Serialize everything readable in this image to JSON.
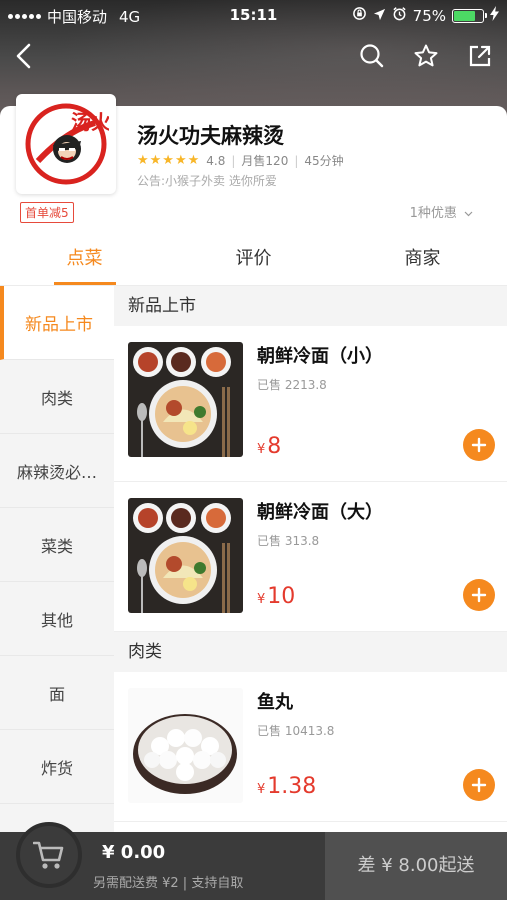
{
  "status_bar": {
    "carrier": "中国移动",
    "network": "4G",
    "time": "15:11",
    "battery": "75%",
    "battery_level": 0.75
  },
  "nav": {
    "back_icon": "back-arrow-icon",
    "search_icon": "search-icon",
    "favorite_icon": "star-icon",
    "share_icon": "share-icon"
  },
  "shop": {
    "name": "汤火功夫麻辣烫",
    "stars": "★★★★★",
    "rating": "4.8",
    "monthly_sales": "月售120",
    "delivery_time": "45分钟",
    "notice": "公告:小猴子外卖 选你所爱",
    "promo_tag": "首单减5",
    "promo_more": "1种优惠",
    "logo_text": "汤火"
  },
  "tabs": [
    {
      "label": "点菜"
    },
    {
      "label": "评价"
    },
    {
      "label": "商家"
    }
  ],
  "categories": [
    {
      "label": "新品上市"
    },
    {
      "label": "肉类"
    },
    {
      "label": "麻辣烫必…"
    },
    {
      "label": "菜类"
    },
    {
      "label": "其他"
    },
    {
      "label": "面"
    },
    {
      "label": "炸货"
    }
  ],
  "sections": [
    {
      "title": "新品上市",
      "items": [
        {
          "name": "朝鲜冷面（小）",
          "sold": "已售 2213.8",
          "currency": "¥",
          "price": "8"
        },
        {
          "name": "朝鲜冷面（大）",
          "sold": "已售 313.8",
          "currency": "¥",
          "price": "10"
        }
      ]
    },
    {
      "title": "肉类",
      "items": [
        {
          "name": "鱼丸",
          "sold": "已售 10413.8",
          "currency": "¥",
          "price": "1.38"
        }
      ]
    }
  ],
  "cart": {
    "total": "¥ 0.00",
    "sub": "另需配送费 ¥2 | 支持自取",
    "checkout": "差 ¥ 8.00起送"
  },
  "colors": {
    "accent": "#f5891e",
    "price": "#e43a2d",
    "star": "#f8b629"
  }
}
